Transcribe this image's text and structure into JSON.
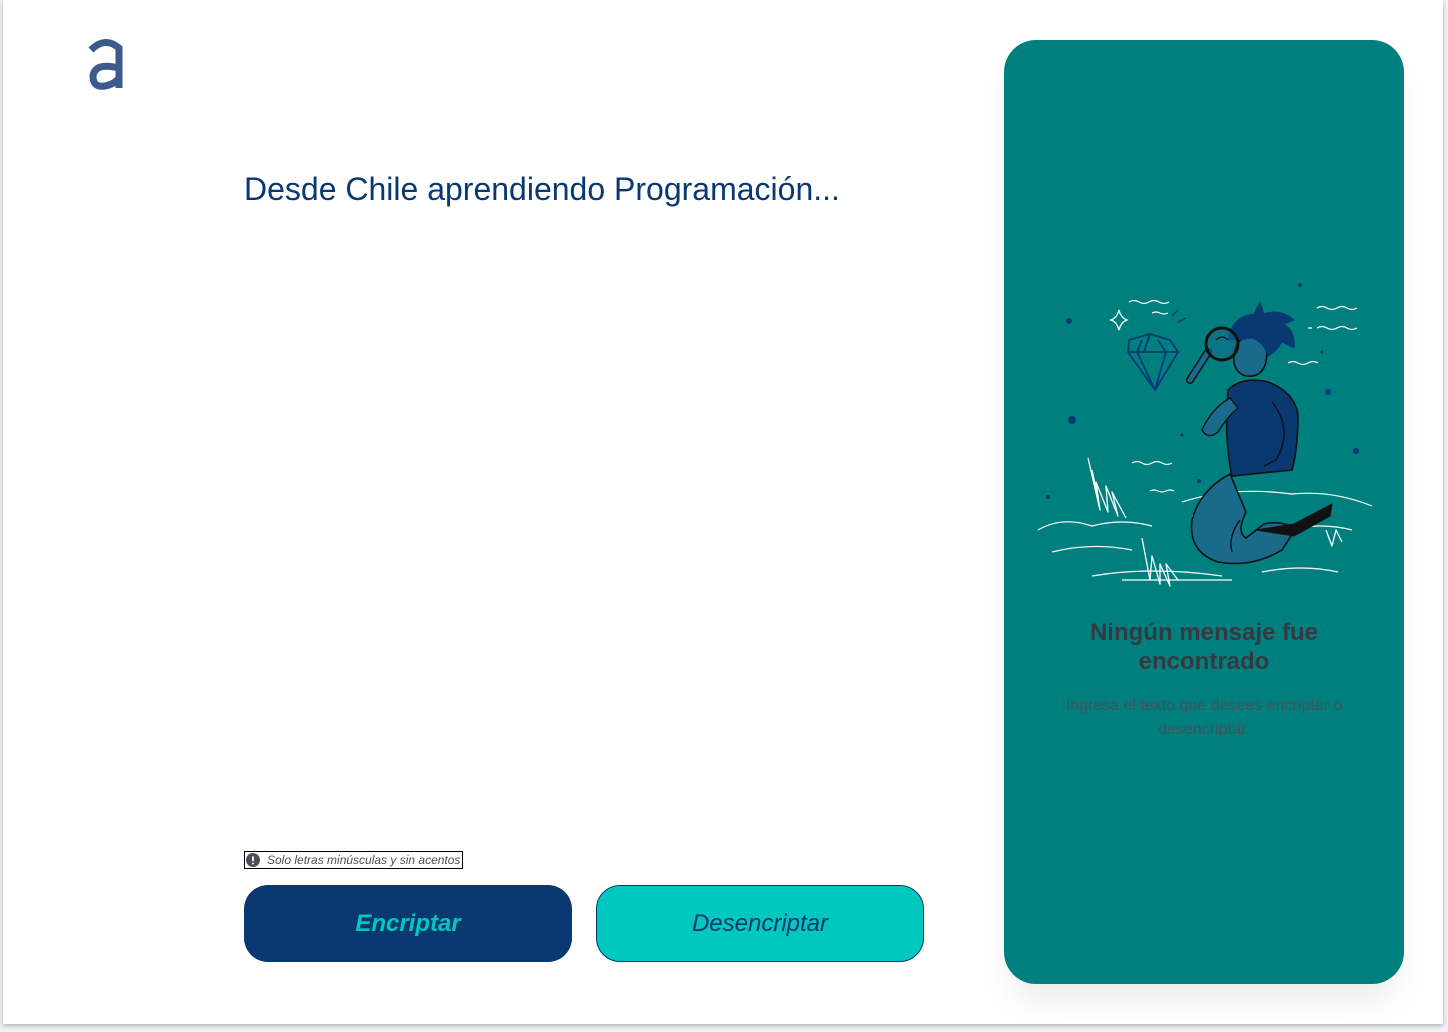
{
  "app": {
    "logo": "alura-logo-icon",
    "colors": {
      "primary": "#0a3871",
      "accent": "#00c8be",
      "panel": "#007f7f"
    }
  },
  "editor": {
    "text": "Desde Chile aprendiendo Programación..."
  },
  "hint": {
    "icon": "exclamation-circle-icon",
    "text": "Solo letras minúsculas y sin acentos"
  },
  "actions": {
    "encrypt_label": "Encriptar",
    "decrypt_label": "Desencriptar"
  },
  "output": {
    "illustration": "boy-with-magnifying-glass-illustration",
    "title": "Ningún mensaje fue encontrado",
    "description": "Ingresa el texto que desees encriptar o desencriptar."
  }
}
